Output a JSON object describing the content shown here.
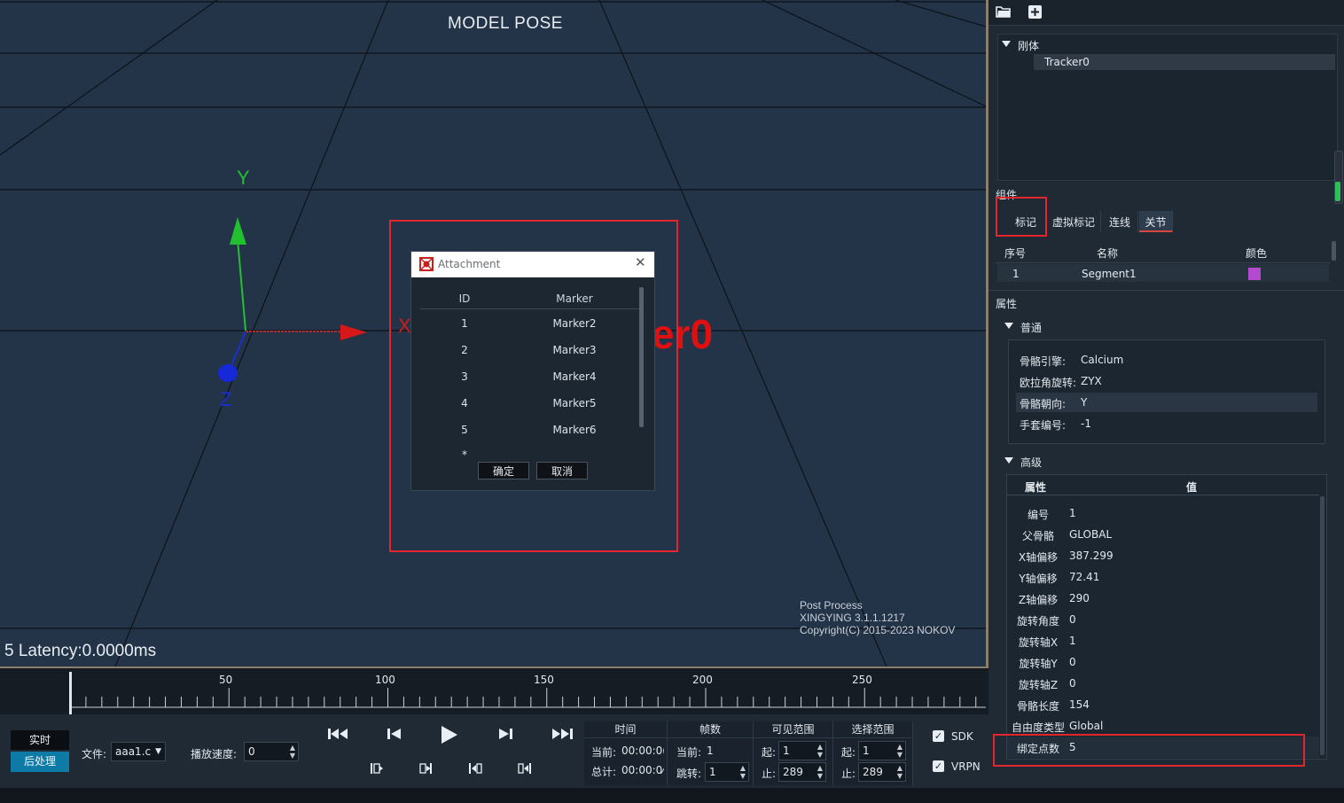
{
  "viewport": {
    "title": "MODEL POSE",
    "latency": "5 Latency:0.0000ms",
    "version_lines": [
      "Post Process",
      "XINGYING 3.1.1.1217",
      "Copyright(C) 2015-2023 NOKOV"
    ],
    "background_label": "er0",
    "axes": {
      "y": "Y",
      "x": "X",
      "z": "Z"
    }
  },
  "dialog": {
    "title": "Attachment",
    "columns": {
      "id": "ID",
      "marker": "Marker"
    },
    "rows": [
      {
        "id": "1",
        "marker": "Marker2"
      },
      {
        "id": "2",
        "marker": "Marker3"
      },
      {
        "id": "3",
        "marker": "Marker4"
      },
      {
        "id": "4",
        "marker": "Marker5"
      },
      {
        "id": "5",
        "marker": "Marker6"
      }
    ],
    "new_row": "*",
    "ok_label": "确定",
    "cancel_label": "取消"
  },
  "panel": {
    "tree": {
      "root": "刚体",
      "child": "Tracker0"
    },
    "components_label": "组件",
    "tabs": [
      "标记",
      "虚拟标记",
      "连线",
      "关节"
    ],
    "comp_columns": {
      "index": "序号",
      "name": "名称",
      "color": "颜色"
    },
    "segment": {
      "index": "1",
      "name": "Segment1",
      "color": "#b44ad0"
    },
    "properties_label": "属性",
    "normal_label": "普通",
    "normal": [
      {
        "k": "骨骼引擎:",
        "v": "Calcium"
      },
      {
        "k": "欧拉角旋转:",
        "v": "ZYX"
      },
      {
        "k": "骨骼朝向:",
        "v": "Y"
      },
      {
        "k": "手套编号:",
        "v": "-1"
      }
    ],
    "advanced_label": "高级",
    "adv_columns": {
      "prop": "属性",
      "value": "值"
    },
    "advanced": [
      {
        "k": "编号",
        "v": "1"
      },
      {
        "k": "父骨骼",
        "v": "GLOBAL"
      },
      {
        "k": "X轴偏移",
        "v": "387.299"
      },
      {
        "k": "Y轴偏移",
        "v": "72.41"
      },
      {
        "k": "Z轴偏移",
        "v": "290"
      },
      {
        "k": "旋转角度",
        "v": "0"
      },
      {
        "k": "旋转轴X",
        "v": "1"
      },
      {
        "k": "旋转轴Y",
        "v": "0"
      },
      {
        "k": "旋转轴Z",
        "v": "0"
      },
      {
        "k": "骨骼长度",
        "v": "154"
      },
      {
        "k": "自由度类型",
        "v": "Global"
      },
      {
        "k": "绑定点数",
        "v": "5"
      }
    ]
  },
  "timeline": {
    "ticks": [
      "50",
      "100",
      "150",
      "200",
      "250"
    ]
  },
  "controls": {
    "realtime": "实时",
    "postprocess": "后处理",
    "file_label": "文件:",
    "file_value": "aaa1.c",
    "speed_label": "播放速度:",
    "speed_value": "0",
    "time": {
      "head": "时间",
      "current_label": "当前:",
      "current_value": "00:00:0(",
      "total_label": "总计:",
      "total_value": "00:00:0⁄"
    },
    "frames": {
      "head": "帧数",
      "current_label": "当前:",
      "current_value": "1",
      "jump_label": "跳转:",
      "jump_value": "1"
    },
    "visible": {
      "head": "可见范围",
      "start_label": "起:",
      "start_value": "1",
      "end_label": "止:",
      "end_value": "289"
    },
    "selection": {
      "head": "选择范围",
      "start_label": "起:",
      "start_value": "1",
      "end_label": "止:",
      "end_value": "289"
    },
    "sdk": "SDK",
    "vrpn": "VRPN"
  }
}
